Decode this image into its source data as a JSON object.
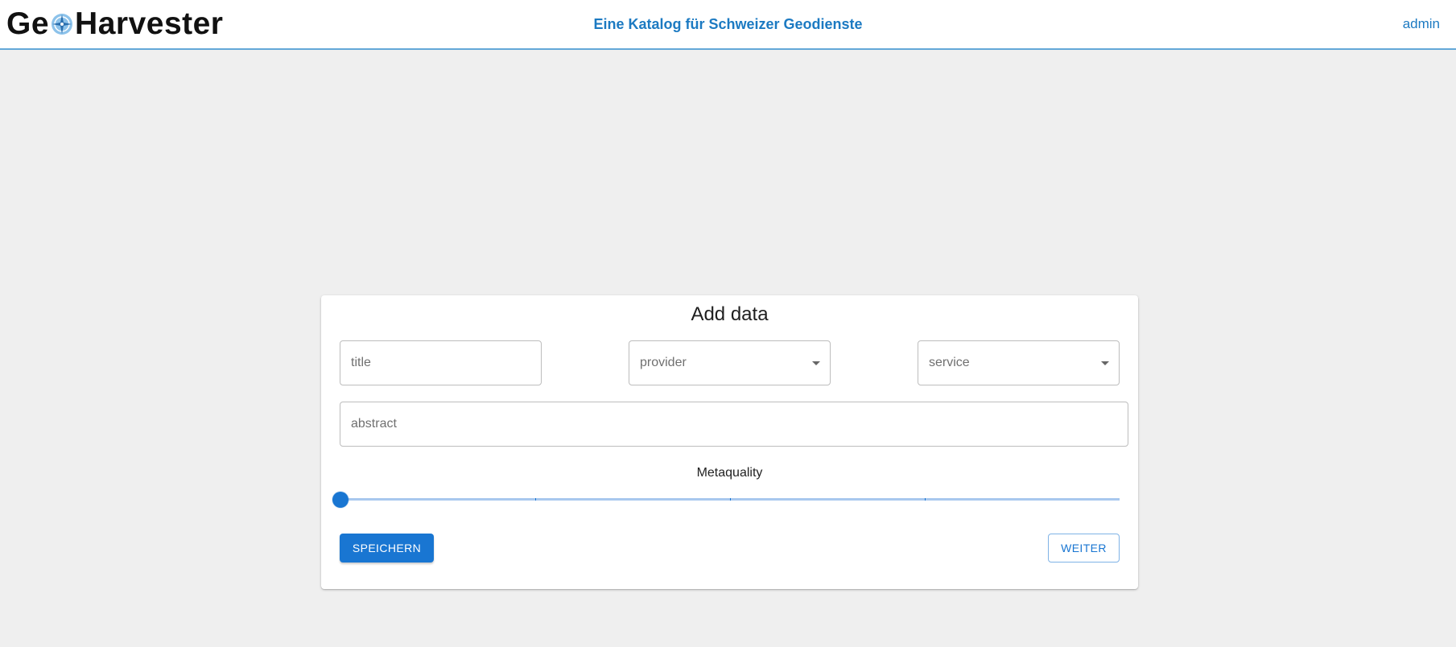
{
  "header": {
    "logo_prefix": "Ge",
    "logo_suffix": "Harvester",
    "tagline": "Eine Katalog für Schweizer Geodienste",
    "user_link": "admin"
  },
  "form": {
    "title": "Add data",
    "fields": {
      "title_placeholder": "title",
      "provider_placeholder": "provider",
      "service_placeholder": "service",
      "abstract_placeholder": "abstract"
    },
    "slider": {
      "label": "Metaquality",
      "value": 0,
      "steps": 4
    },
    "buttons": {
      "save": "SPEICHERN",
      "next": "WEITER"
    }
  },
  "colors": {
    "accent": "#1976d2",
    "header_text": "#1c7ac2",
    "background": "#efefef"
  }
}
